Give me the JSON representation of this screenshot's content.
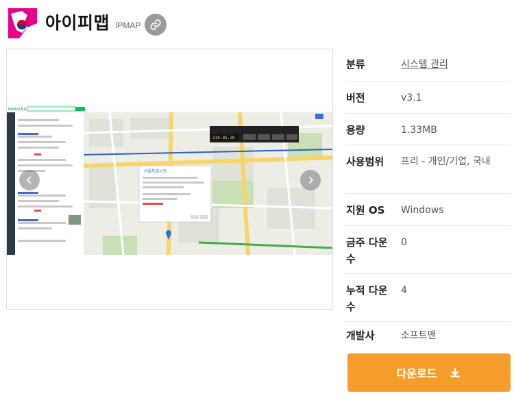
{
  "header": {
    "title": "아이피맵",
    "subtitle": "IPMAP",
    "link_icon": "link-icon"
  },
  "colors": {
    "download_button": "#f59d2a",
    "link_button": "#9a9a9a",
    "naver_green": "#03c75a"
  },
  "screenshot": {
    "naver_logo": "NAVER",
    "map_label": "지도",
    "popup_title": "서울특별시청",
    "toolbar_value": "210.85.30"
  },
  "info": {
    "rows": [
      {
        "key": "분류",
        "value": "시스템 관리"
      },
      {
        "key": "버전",
        "value": "v3.1"
      },
      {
        "key": "용량",
        "value": "1.33MB"
      },
      {
        "key": "사용범위",
        "value": "프리 - 개인/기업, 국내"
      },
      {
        "key": "지원 OS",
        "value": "Windows"
      },
      {
        "key": "금주 다운수",
        "value": "0"
      },
      {
        "key": "누적 다운수",
        "value": "4"
      },
      {
        "key": "개발사",
        "value": "소프트맨"
      }
    ]
  },
  "download": {
    "label": "다운로드",
    "icon": "download-icon"
  }
}
